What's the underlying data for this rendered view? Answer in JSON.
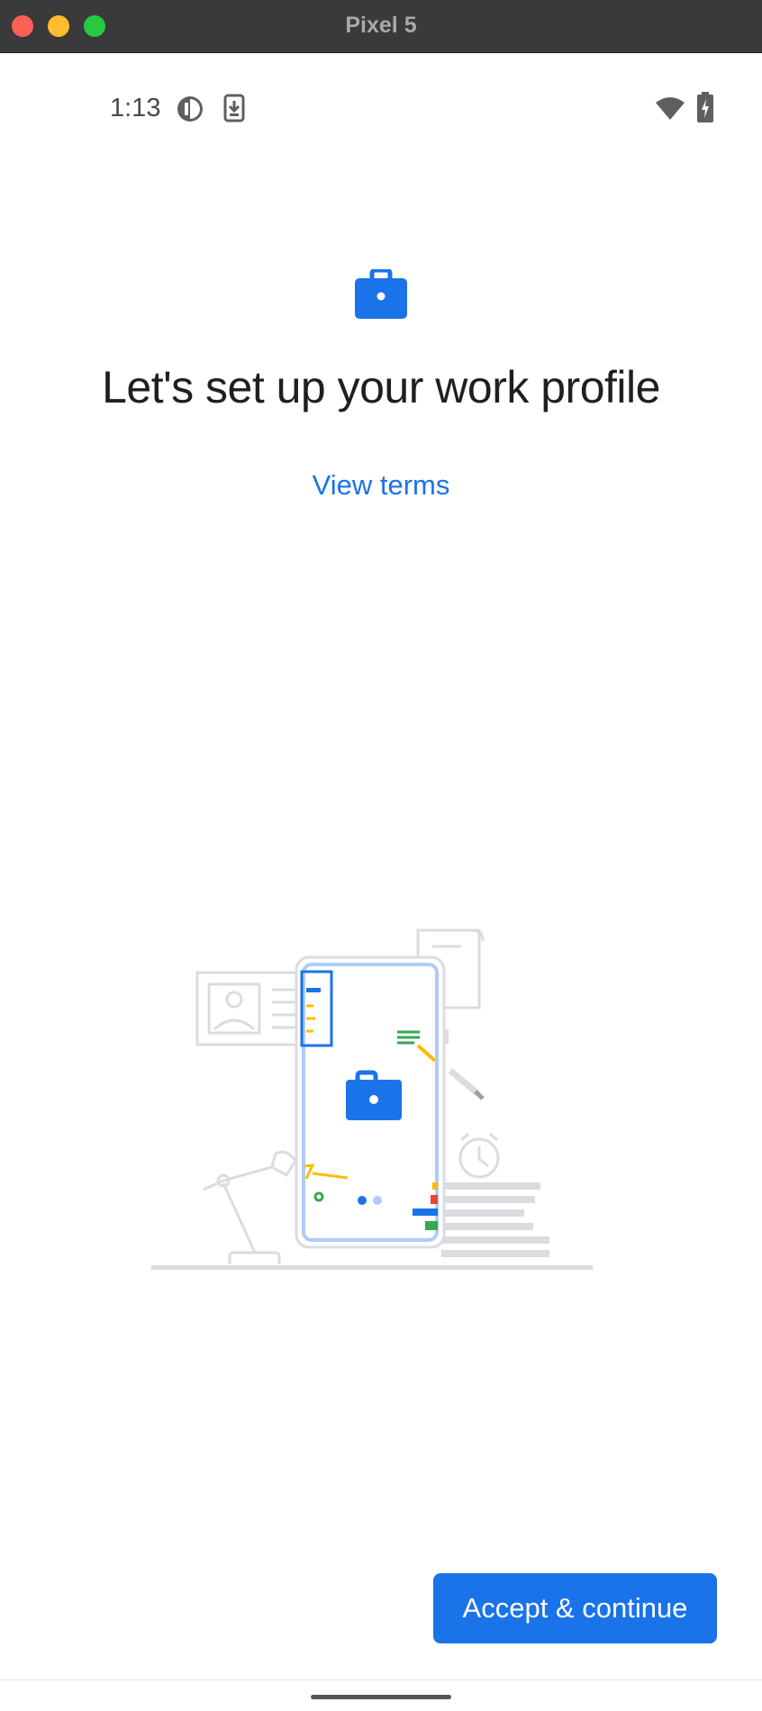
{
  "window": {
    "title": "Pixel 5"
  },
  "status_bar": {
    "time": "1:13",
    "left_icons": [
      "data-saver-icon",
      "download-icon"
    ],
    "right_icons": [
      "wifi-icon",
      "battery-charging-icon"
    ]
  },
  "main": {
    "icon": "briefcase-icon",
    "headline": "Let's set up your work profile",
    "view_terms_label": "View terms"
  },
  "footer": {
    "accept_label": "Accept & continue"
  },
  "colors": {
    "accent": "#1a73e8",
    "text": "#1f1f1f",
    "titlebar": "#3a393b"
  }
}
